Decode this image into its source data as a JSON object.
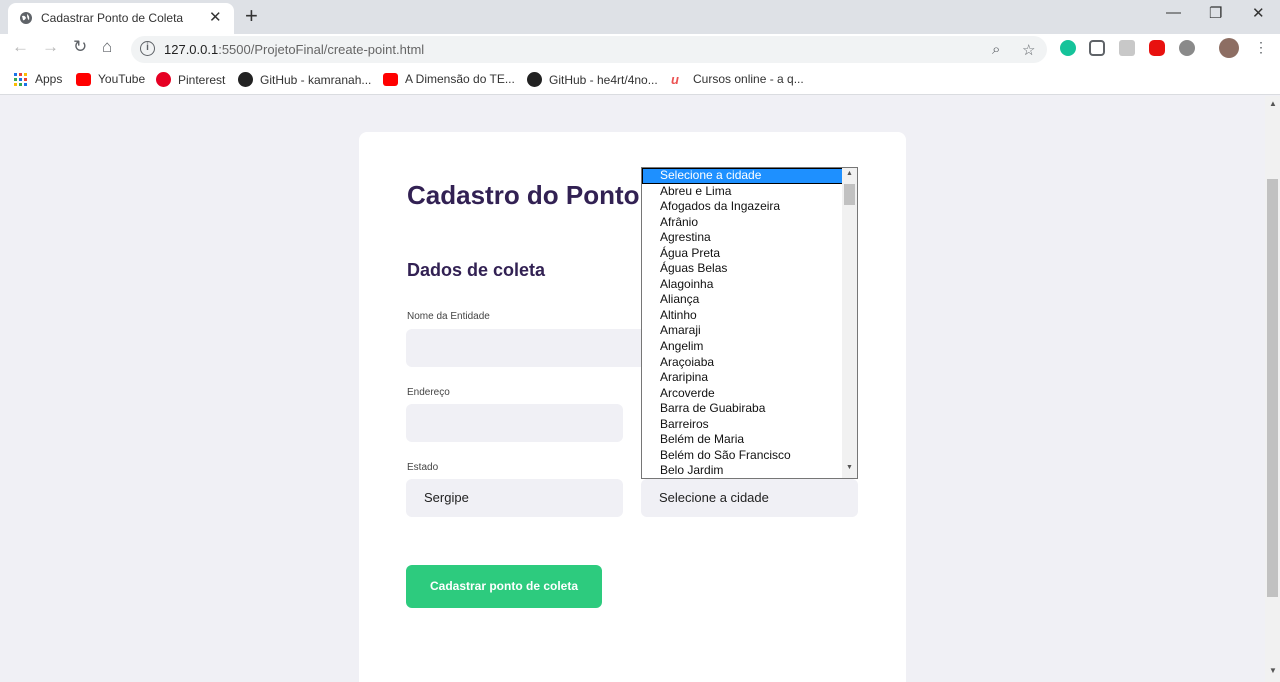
{
  "browser": {
    "tab_title": "Cadastrar Ponto de Coleta",
    "url_host": "127.0.0.1",
    "url_rest": ":5500/ProjetoFinal/create-point.html",
    "bookmarks": [
      {
        "label": "Apps",
        "icon": "apps-grid-icon"
      },
      {
        "label": "YouTube",
        "icon": "youtube-icon"
      },
      {
        "label": "Pinterest",
        "icon": "pinterest-icon"
      },
      {
        "label": "GitHub - kamranah...",
        "icon": "github-icon"
      },
      {
        "label": "A Dimensão do TE...",
        "icon": "youtube-icon"
      },
      {
        "label": "GitHub - he4rt/4no...",
        "icon": "github-icon"
      },
      {
        "label": "Cursos online - a q...",
        "icon": "udemy-icon"
      }
    ]
  },
  "form": {
    "heading": "Cadastro do Ponto",
    "section_title": "Dados de coleta",
    "entity_label": "Nome da Entidade",
    "address_label": "Endereço",
    "state_label": "Estado",
    "state_value": "Sergipe",
    "city_value": "Selecione a cidade",
    "submit_label": "Cadastrar ponto de coleta"
  },
  "city_dropdown": {
    "options": [
      "Selecione a cidade",
      "Abreu e Lima",
      "Afogados da Ingazeira",
      "Afrânio",
      "Agrestina",
      "Água Preta",
      "Águas Belas",
      "Alagoinha",
      "Aliança",
      "Altinho",
      "Amaraji",
      "Angelim",
      "Araçoiaba",
      "Araripina",
      "Arcoverde",
      "Barra de Guabiraba",
      "Barreiros",
      "Belém de Maria",
      "Belém do São Francisco",
      "Belo Jardim"
    ]
  },
  "colors": {
    "accent": "#2dcb7e",
    "heading": "#322153",
    "selected_option": "#1e90ff"
  }
}
